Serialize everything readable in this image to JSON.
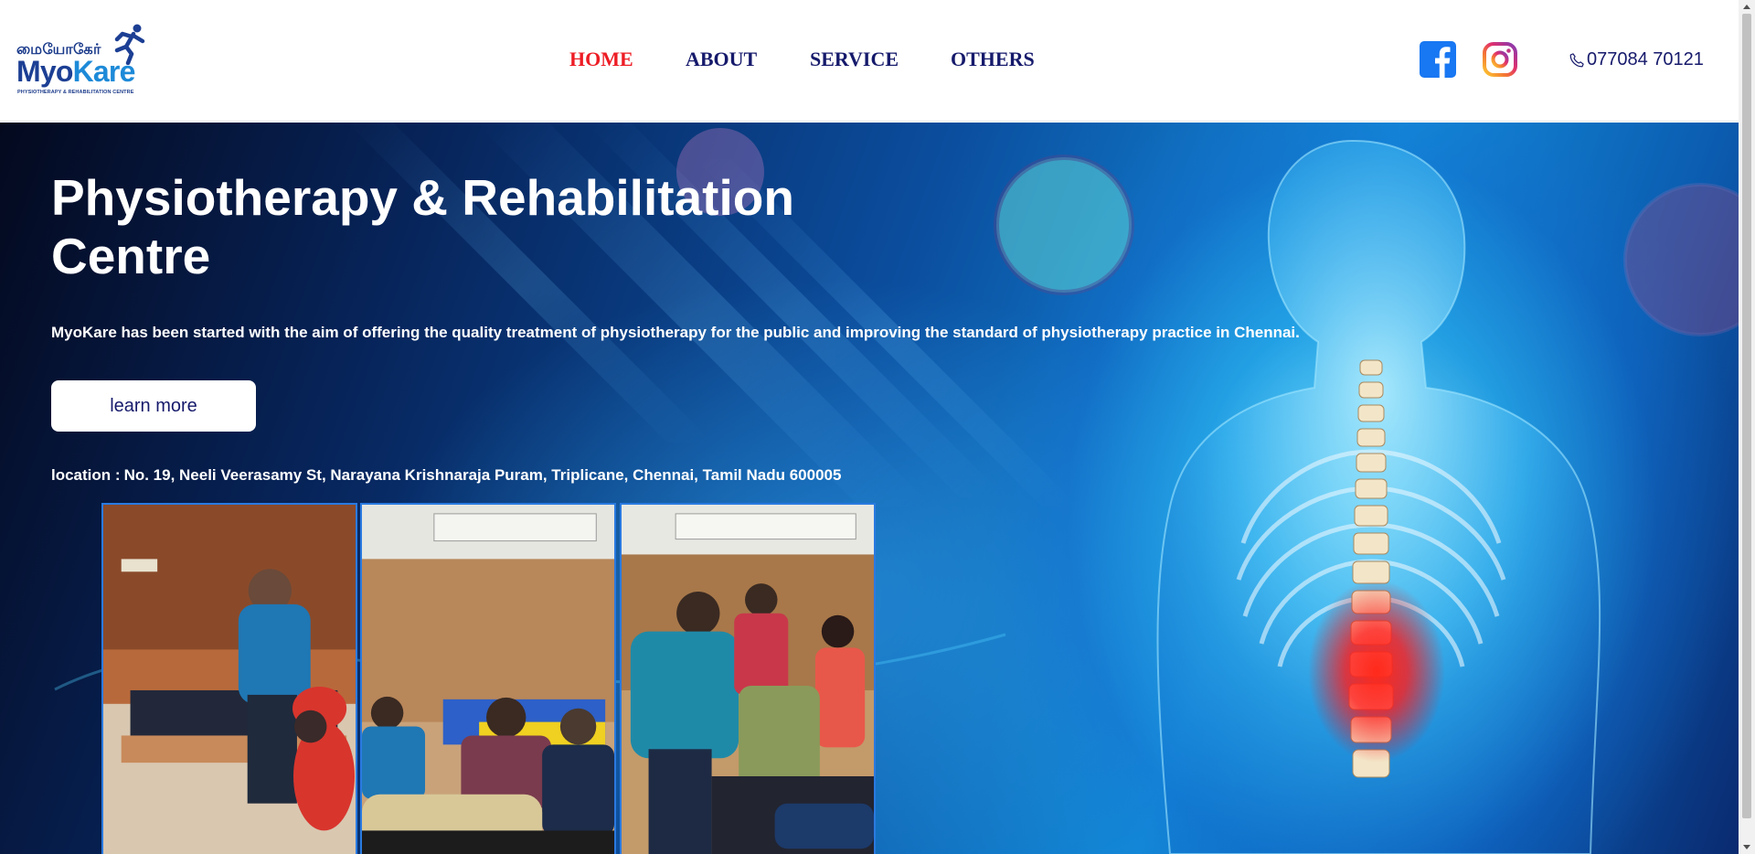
{
  "header": {
    "logo": {
      "tamil_text": "மையோகேர்",
      "brand_prefix": "Myo",
      "brand_suffix": "Kare",
      "tagline": "PHYSIOTHERAPY & REHABILITATION CENTRE",
      "icon": "runner-icon"
    },
    "nav": [
      {
        "label": "HOME",
        "active": true
      },
      {
        "label": "ABOUT",
        "active": false
      },
      {
        "label": "SERVICE",
        "active": false
      },
      {
        "label": "OTHERS",
        "active": false
      }
    ],
    "social": [
      {
        "icon": "facebook-icon"
      },
      {
        "icon": "instagram-icon"
      }
    ],
    "phone": {
      "icon": "phone-icon",
      "number": "077084 70121"
    }
  },
  "hero": {
    "title": "Physiotherapy & Rehabilitation Centre",
    "description": "MyoKare has been started with the aim of offering the quality treatment of physiotherapy for the public and improving the standard of physiotherapy practice in Chennai.",
    "button_label": "learn more",
    "location_label": "location :",
    "location_value": "No. 19, Neeli Veerasamy St, Narayana Krishnaraja Puram, Triplicane, Chennai, Tamil Nadu 600005",
    "photos": [
      {
        "name": "photo-therapy-session-1"
      },
      {
        "name": "photo-therapy-session-2"
      },
      {
        "name": "photo-therapy-session-3"
      }
    ],
    "background_illustration": "spine-anatomy-illustration"
  },
  "colors": {
    "nav_text": "#161a6b",
    "nav_active": "#ed1c24",
    "brand_blue": "#1c3f94",
    "hero_text": "#ffffff",
    "facebook": "#1877f2"
  }
}
